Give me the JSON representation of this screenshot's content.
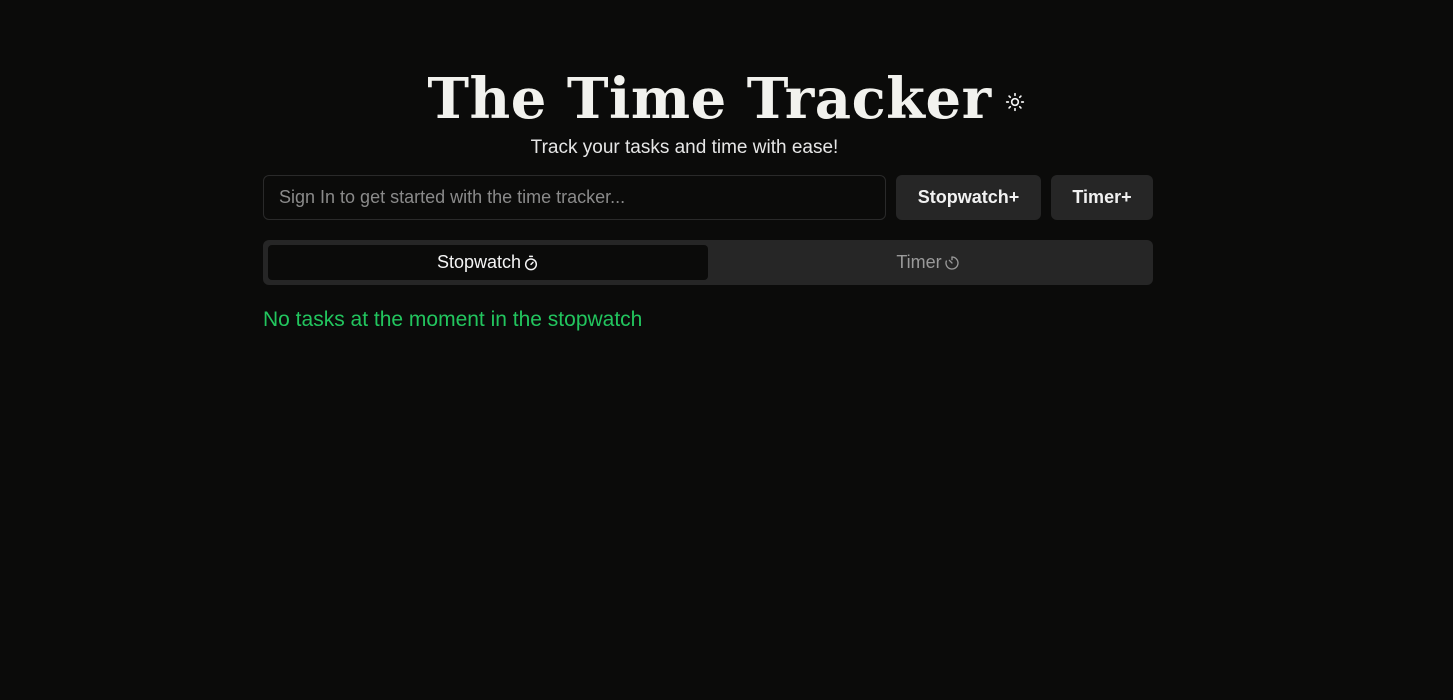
{
  "header": {
    "title": "The Time Tracker",
    "subtitle": "Track your tasks and time with ease!",
    "theme_toggle_icon": "sun-icon"
  },
  "task_input": {
    "value": "",
    "placeholder": "Sign In to get started with the time tracker..."
  },
  "actions": {
    "stopwatch_label": "Stopwatch+",
    "timer_label": "Timer+"
  },
  "tabs": [
    {
      "label": "Stopwatch",
      "icon": "stopwatch-icon",
      "active": true
    },
    {
      "label": "Timer",
      "icon": "timer-icon",
      "active": false
    }
  ],
  "empty_state": {
    "message": "No tasks at the moment in the stopwatch"
  },
  "colors": {
    "background": "#0b0b0a",
    "surface": "#262626",
    "accent_green": "#22c55e"
  }
}
